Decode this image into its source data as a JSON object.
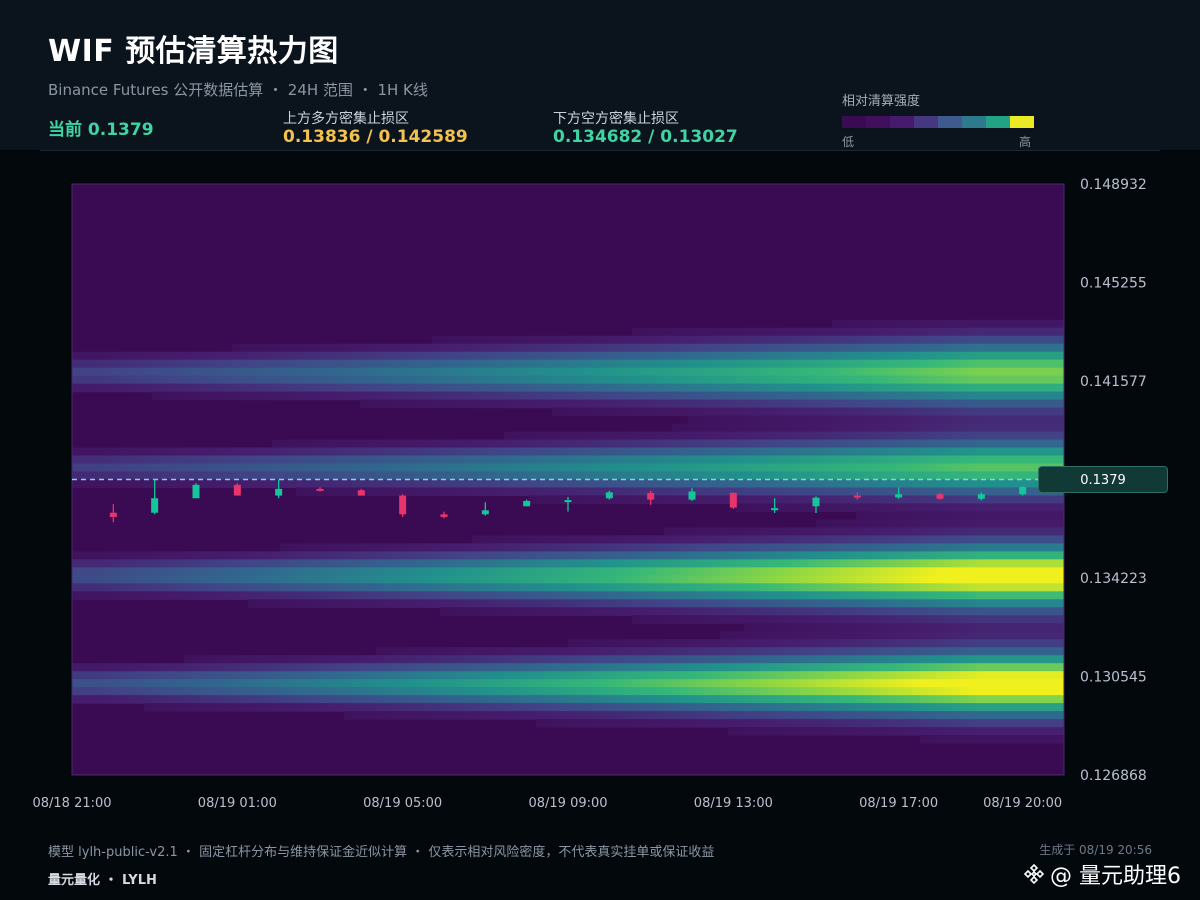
{
  "header": {
    "title": "WIF 预估清算热力图",
    "subtitle": "Binance Futures 公开数据估算 ・ 24H 范围 ・ 1H K线",
    "current_label": "当前 0.1379",
    "upper_zone_label": "上方多方密集止损区",
    "upper_zone_value": "0.13836 / 0.142589",
    "lower_zone_label": "下方空方密集止损区",
    "lower_zone_value": "0.134682 / 0.13027",
    "legend_title": "相对清算强度",
    "legend_low": "低",
    "legend_high": "高",
    "legend_colors": [
      "#3a0a52",
      "#420f5e",
      "#461a6c",
      "#463880",
      "#3f5a8f",
      "#2c7a8c",
      "#22a384",
      "#eaea25"
    ]
  },
  "chart_data": {
    "type": "heatmap",
    "title": "WIF 预估清算热力图",
    "current_price": 0.1379,
    "current_price_label": "0.1379",
    "y_ticks": [
      "0.148932",
      "0.145255",
      "0.141577",
      "0.134223",
      "0.130545",
      "0.126868"
    ],
    "y_tick_values": [
      0.148932,
      0.145255,
      0.141577,
      0.134223,
      0.130545,
      0.126868
    ],
    "ylim": [
      0.126868,
      0.148932
    ],
    "x_ticks": [
      "08/18 21:00",
      "08/19 01:00",
      "08/19 05:00",
      "08/19 09:00",
      "08/19 13:00",
      "08/19 17:00",
      "08/19 20:00"
    ],
    "x_tick_hours": [
      0,
      4,
      8,
      12,
      16,
      20,
      23
    ],
    "hours": 24,
    "colors": {
      "up": "#14c79a",
      "down": "#e8346d",
      "price_line": "#7fd6d6",
      "background": "#3a0a52"
    },
    "bands": [
      {
        "center": 0.14187,
        "width": 0.00085,
        "strength": 0.85,
        "growth": 0.55
      },
      {
        "center": 0.13836,
        "width": 0.00075,
        "strength": 0.8,
        "growth": 0.55
      },
      {
        "center": 0.1343,
        "width": 0.00085,
        "strength": 1.0,
        "growth": 0.6
      },
      {
        "center": 0.13027,
        "width": 0.00085,
        "strength": 1.0,
        "growth": 0.6
      }
    ],
    "candles": [
      {
        "o": 0.13666,
        "h": 0.13698,
        "l": 0.1363,
        "c": 0.1365
      },
      {
        "o": 0.13666,
        "h": 0.1379,
        "l": 0.1366,
        "c": 0.1372
      },
      {
        "o": 0.1372,
        "h": 0.13776,
        "l": 0.1372,
        "c": 0.1377
      },
      {
        "o": 0.1377,
        "h": 0.13776,
        "l": 0.1373,
        "c": 0.1373
      },
      {
        "o": 0.1373,
        "h": 0.13789,
        "l": 0.1372,
        "c": 0.13755
      },
      {
        "o": 0.13755,
        "h": 0.13761,
        "l": 0.13745,
        "c": 0.1375
      },
      {
        "o": 0.1375,
        "h": 0.13755,
        "l": 0.13732,
        "c": 0.1373
      },
      {
        "o": 0.1373,
        "h": 0.13735,
        "l": 0.1365,
        "c": 0.1366
      },
      {
        "o": 0.1366,
        "h": 0.1367,
        "l": 0.13645,
        "c": 0.1365
      },
      {
        "o": 0.1366,
        "h": 0.13705,
        "l": 0.13655,
        "c": 0.13675
      },
      {
        "o": 0.1369,
        "h": 0.13715,
        "l": 0.1369,
        "c": 0.1371
      },
      {
        "o": 0.1371,
        "h": 0.13725,
        "l": 0.1367,
        "c": 0.13713
      },
      {
        "o": 0.1372,
        "h": 0.13748,
        "l": 0.13715,
        "c": 0.13742
      },
      {
        "o": 0.1374,
        "h": 0.13748,
        "l": 0.13695,
        "c": 0.13715
      },
      {
        "o": 0.13715,
        "h": 0.13758,
        "l": 0.1371,
        "c": 0.13745
      },
      {
        "o": 0.1374,
        "h": 0.13742,
        "l": 0.1368,
        "c": 0.13685
      },
      {
        "o": 0.1368,
        "h": 0.1372,
        "l": 0.13665,
        "c": 0.13683
      },
      {
        "o": 0.1369,
        "h": 0.13727,
        "l": 0.13665,
        "c": 0.13722
      },
      {
        "o": 0.1373,
        "h": 0.13742,
        "l": 0.13715,
        "c": 0.13723
      },
      {
        "o": 0.13723,
        "h": 0.1376,
        "l": 0.13718,
        "c": 0.13735
      },
      {
        "o": 0.13735,
        "h": 0.1374,
        "l": 0.13715,
        "c": 0.13718
      },
      {
        "o": 0.13718,
        "h": 0.13742,
        "l": 0.13712,
        "c": 0.13735
      },
      {
        "o": 0.13735,
        "h": 0.13765,
        "l": 0.1373,
        "c": 0.13762
      },
      {
        "o": 0.13762,
        "h": 0.1379,
        "l": 0.13758,
        "c": 0.1379
      }
    ]
  },
  "footer": {
    "note": "模型 lylh-public-v2.1 ・ 固定杠杆分布与维持保证金近似计算 ・ 仅表示相对风险密度，不代表真实挂单或保证收益",
    "brand": "量元量化 ・ LYLH",
    "generated": "生成于 08/19 20:56",
    "watermark": "@ 量元助理6"
  }
}
